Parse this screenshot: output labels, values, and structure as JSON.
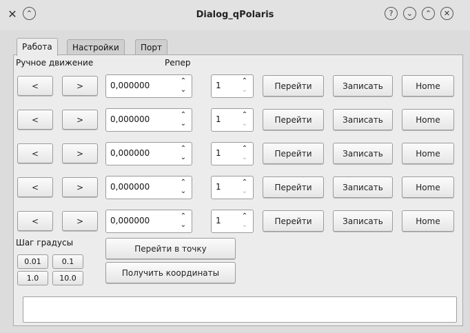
{
  "window": {
    "title": "Dialog_qPolaris"
  },
  "tabs": [
    "Работа",
    "Настройки",
    "Порт"
  ],
  "labels": {
    "manual": "Ручное движение",
    "reper": "Репер",
    "step": "Шаг градусы"
  },
  "rows": [
    {
      "left": "<",
      "right": ">",
      "position": "0,000000",
      "reper": "1",
      "goto": "Перейти",
      "write": "Записать",
      "home": "Home"
    },
    {
      "left": "<",
      "right": ">",
      "position": "0,000000",
      "reper": "1",
      "goto": "Перейти",
      "write": "Записать",
      "home": "Home"
    },
    {
      "left": "<",
      "right": ">",
      "position": "0,000000",
      "reper": "1",
      "goto": "Перейти",
      "write": "Записать",
      "home": "Home"
    },
    {
      "left": "<",
      "right": ">",
      "position": "0,000000",
      "reper": "1",
      "goto": "Перейти",
      "write": "Записать",
      "home": "Home"
    },
    {
      "left": "<",
      "right": ">",
      "position": "0,000000",
      "reper": "1",
      "goto": "Перейти",
      "write": "Записать",
      "home": "Home"
    }
  ],
  "steps": [
    "0.01",
    "0.1",
    "1.0",
    "10.0"
  ],
  "actions": {
    "goto_point": "Перейти в точку",
    "get_coords": "Получить координаты"
  },
  "status": {
    "text": ""
  }
}
